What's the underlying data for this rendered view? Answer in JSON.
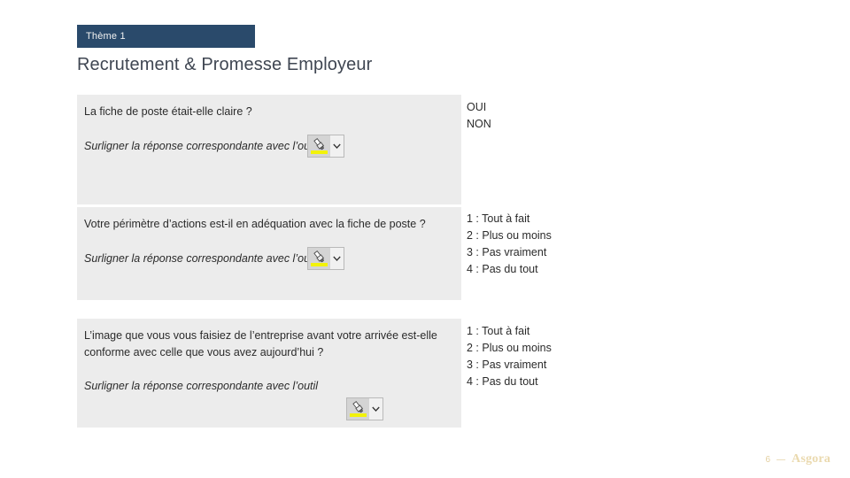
{
  "slide": {
    "theme_label": "Thème 1",
    "title": "Recrutement & Promesse Employeur",
    "banner_color": "#2a4a6b",
    "block_background": "#ececec",
    "title_color": "#3f4652"
  },
  "blocks": [
    {
      "question": "La fiche de poste était-elle claire ?",
      "instruction": "Surligner la réponse correspondante avec l’outil",
      "tool_icon": "highlighter-icon",
      "tool_dropdown_icon": "chevron-down-icon",
      "answers": [
        "OUI",
        "NON"
      ]
    },
    {
      "question": "Votre périmètre d’actions est-il en adéquation avec la fiche de poste ?",
      "instruction": "Surligner la réponse correspondante avec l’outil",
      "tool_icon": "highlighter-icon",
      "tool_dropdown_icon": "chevron-down-icon",
      "answers": [
        "1 : Tout à fait",
        "2 : Plus ou moins",
        "3 : Pas vraiment",
        "4 : Pas du tout"
      ]
    },
    {
      "question": "L’image que vous vous faisiez de l’entreprise avant votre arrivée est-elle conforme avec celle que vous avez aujourd’hui ?",
      "instruction": "Surligner la réponse correspondante avec l’outil",
      "tool_icon": "highlighter-icon",
      "tool_dropdown_icon": "chevron-down-icon",
      "answers": [
        "1 : Tout à fait",
        "2 : Plus ou moins",
        "3 : Pas vraiment",
        "4 : Pas du tout"
      ]
    }
  ],
  "footer": {
    "page_number": "6",
    "separator": "—",
    "logo_text": "Asgora",
    "logo_color": "#ead9ae"
  }
}
